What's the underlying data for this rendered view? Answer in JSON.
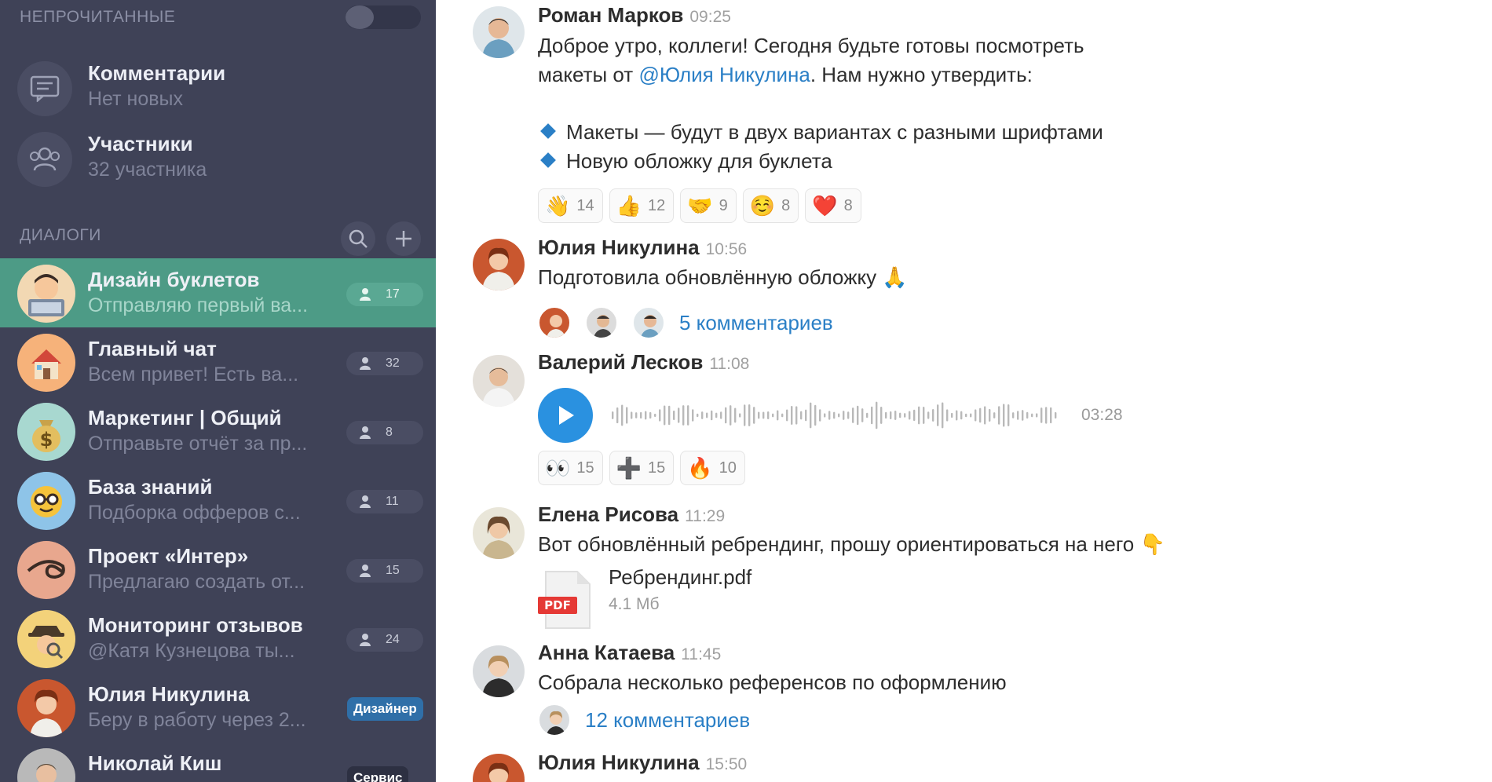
{
  "sidebar": {
    "unread_header": "НЕПРОЧИТАННЫЕ",
    "unread_toggle": "off",
    "meta": [
      {
        "title": "Комментарии",
        "sub": "Нет новых",
        "icon": "comment-icon"
      },
      {
        "title": "Участники",
        "sub": "32 участника",
        "icon": "people-icon"
      }
    ],
    "dialogs_header": "ДИАЛОГИ",
    "dialogs": [
      {
        "title": "Дизайн буклетов",
        "preview": "Отправляю первый ва...",
        "count": "17",
        "avatar": "person-laptop-avatar",
        "active": true
      },
      {
        "title": "Главный чат",
        "preview": "Всем привет! Есть ва...",
        "count": "32",
        "avatar": "house-avatar"
      },
      {
        "title": "Маркетинг | Общий",
        "preview": "Отправьте отчёт за пр...",
        "count": "8",
        "avatar": "money-bag-avatar"
      },
      {
        "title": "База знаний",
        "preview": "Подборка офферов с...",
        "count": "11",
        "avatar": "nerd-face-avatar"
      },
      {
        "title": "Проект «Интер»",
        "preview": "Предлагаю создать от...",
        "count": "15",
        "avatar": "loop-avatar"
      },
      {
        "title": "Мониторинг отзывов",
        "preview": "@Катя Кузнецова ты...",
        "count": "24",
        "avatar": "detective-avatar"
      },
      {
        "title": "Юлия Никулина",
        "preview": "Беру в работу через 2...",
        "tag": "Дизайнер",
        "avatar": "photo-avatar-julia"
      },
      {
        "title": "Николай Киш",
        "preview": "",
        "tag": "Сервис",
        "avatar": "photo-avatar-nikolay"
      }
    ]
  },
  "messages": [
    {
      "author": "Роман Марков",
      "time": "09:25",
      "line1": "Доброе утро, коллеги! Сегодня будьте готовы посмотреть",
      "line2_prefix": "макеты от ",
      "mention": "@Юлия Никулина",
      "line2_suffix": ". Нам нужно утвердить:",
      "bullets": [
        "Макеты — будут в двух вариантах с разными шрифтами",
        "Новую обложку для буклета"
      ],
      "reactions": [
        {
          "emoji": "👋",
          "count": "14",
          "icon": "waving-hand-icon"
        },
        {
          "emoji": "👍",
          "count": "12",
          "icon": "thumbs-up-icon"
        },
        {
          "emoji": "🤝",
          "count": "9",
          "icon": "handshake-icon"
        },
        {
          "emoji": "☺️",
          "count": "8",
          "icon": "smiling-face-icon"
        },
        {
          "emoji": "❤️",
          "count": "8",
          "icon": "heart-icon"
        }
      ]
    },
    {
      "author": "Юлия Никулина",
      "time": "10:56",
      "text": "Подготовила обновлённую обложку 🙏",
      "comments": "5 комментариев"
    },
    {
      "author": "Валерий Лесков",
      "time": "11:08",
      "voice_duration": "03:28",
      "reactions": [
        {
          "emoji": "👀",
          "count": "15",
          "icon": "eyes-icon"
        },
        {
          "emoji": "➕",
          "count": "15",
          "icon": "plus-icon"
        },
        {
          "emoji": "🔥",
          "count": "10",
          "icon": "fire-icon"
        }
      ]
    },
    {
      "author": "Елена Рисова",
      "time": "11:29",
      "text": "Вот обновлённый ребрендинг, прошу ориентироваться на него 👇",
      "file_name": "Ребрендинг.pdf",
      "file_size": "4.1 Мб",
      "file_type": "PDF"
    },
    {
      "author": "Анна Катаева",
      "time": "11:45",
      "text": "Собрала несколько референсов по оформлению",
      "comments": "12 комментариев"
    },
    {
      "author": "Юлия Никулина",
      "time": "15:50"
    }
  ],
  "colors": {
    "sidebar_bg": "#3f4257",
    "active_dialog": "#4d9b86",
    "accent_link": "#2a7fc6",
    "play_button": "#2a91e0",
    "tag_designer": "#2f6fa8"
  }
}
